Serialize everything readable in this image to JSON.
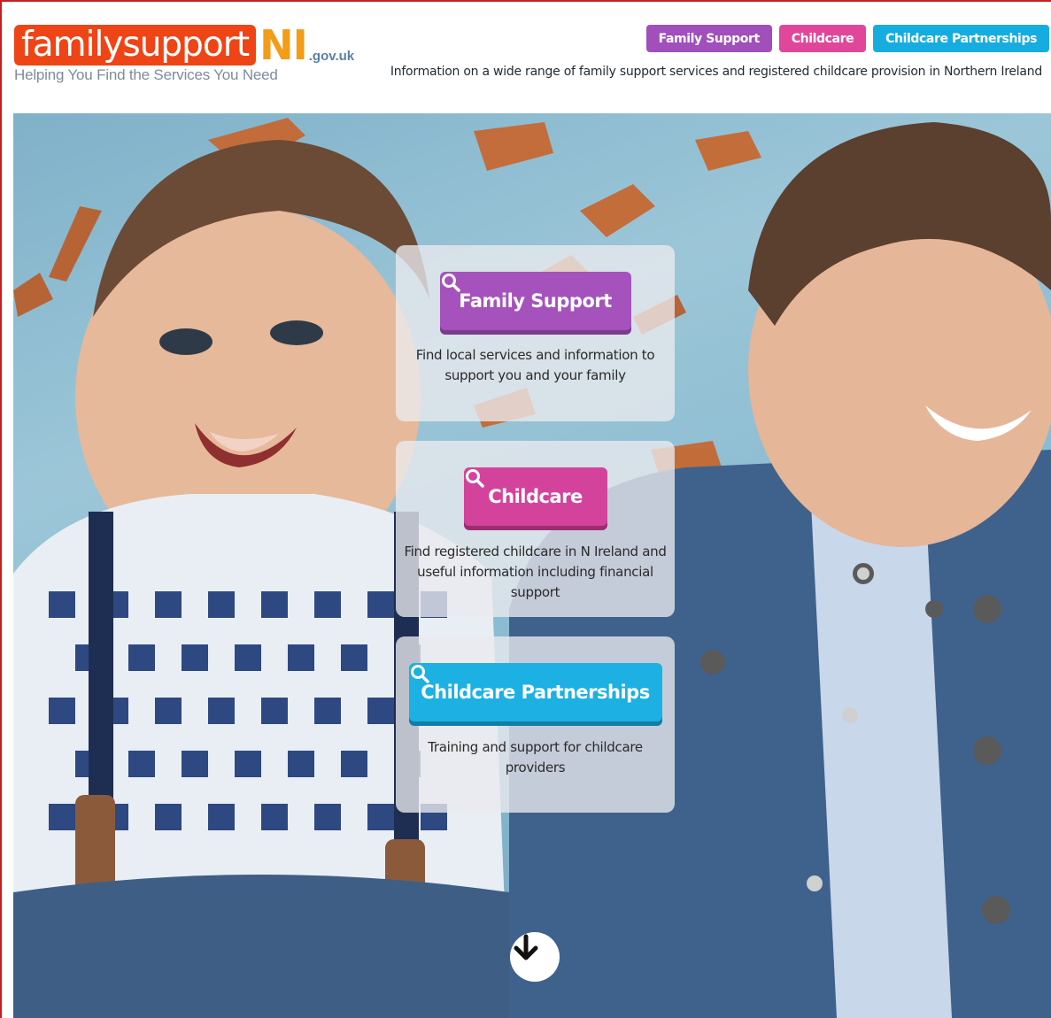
{
  "header": {
    "logo": {
      "word": "familysupport",
      "ni": "NI",
      "domain": ".gov.uk"
    },
    "tagline": "Helping You Find the Services You Need",
    "nav": [
      {
        "label": "Family Support",
        "color": "#a04fbb"
      },
      {
        "label": "Childcare",
        "color": "#e0479a"
      },
      {
        "label": "Childcare Partnerships",
        "color": "#17ace0"
      }
    ],
    "info": "Information on a wide range of family support services and registered childcare provision in Northern Ireland"
  },
  "cards": [
    {
      "button_label": "Family Support",
      "button_color": "#a552bd",
      "icon": "search-icon",
      "description": "Find local services and information to support you and your family"
    },
    {
      "button_label": "Childcare",
      "button_color": "#d3439c",
      "icon": "search-icon",
      "description": "Find registered childcare in N Ireland and useful information including financial support"
    },
    {
      "button_label": "Childcare Partnerships",
      "button_color": "#1cb0e3",
      "icon": "search-icon",
      "description": "Training and support for childcare providers"
    }
  ],
  "hero": {
    "image": "two-smiling-children-photo",
    "scroll_icon": "arrow-down-circle-icon"
  },
  "colors": {
    "brand_orange": "#ef4416",
    "brand_ni": "#f39c17",
    "frame_red": "#c51f1f"
  }
}
